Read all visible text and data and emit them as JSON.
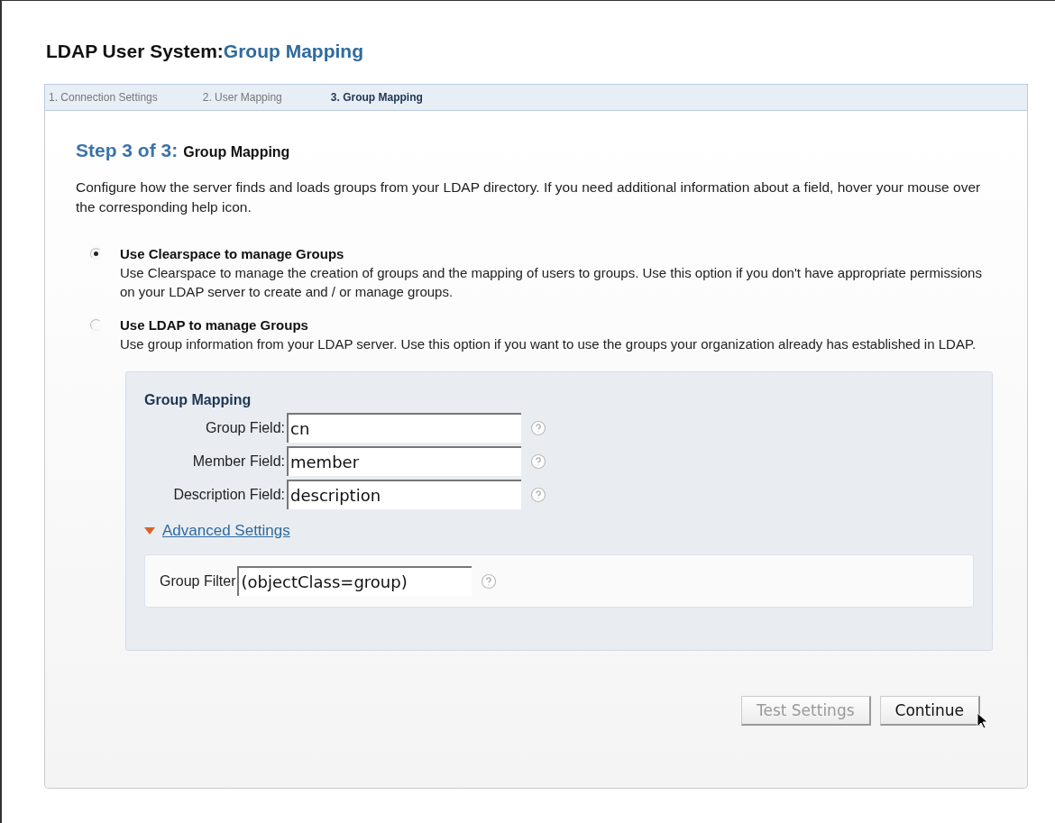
{
  "page_title": {
    "prefix": "LDAP User System:",
    "section": "Group Mapping"
  },
  "steps": [
    {
      "label": "1. Connection Settings",
      "selected": false
    },
    {
      "label": "2. User Mapping",
      "selected": false
    },
    {
      "label": "3. Group Mapping",
      "selected": true
    }
  ],
  "step_heading": {
    "counter": "Step 3 of 3:",
    "title": "Group Mapping"
  },
  "intro": "Configure how the server finds and loads groups from your LDAP directory. If you need additional information about a field, hover your mouse over the corresponding help icon.",
  "options": [
    {
      "label": "Use Clearspace to manage Groups",
      "description": "Use Clearspace to manage the creation of groups and the mapping of users to groups. Use this option if you don't have appropriate permissions on your LDAP server to create and / or manage groups.",
      "selected": true
    },
    {
      "label": "Use LDAP to manage Groups",
      "description": "Use group information from your LDAP server. Use this option if you want to use the groups your organization already has established in LDAP.",
      "selected": false
    }
  ],
  "group_mapping": {
    "title": "Group Mapping",
    "fields": [
      {
        "label": "Group Field:",
        "value": "cn"
      },
      {
        "label": "Member Field:",
        "value": "member"
      },
      {
        "label": "Description Field:",
        "value": "description"
      }
    ],
    "advanced": {
      "label": "Advanced Settings",
      "expanded": true,
      "fields": [
        {
          "label": "Group Filter",
          "value": "(objectClass=group)"
        }
      ]
    }
  },
  "buttons": [
    {
      "label": "Test Settings",
      "disabled": true
    },
    {
      "label": "Continue",
      "disabled": false
    }
  ]
}
